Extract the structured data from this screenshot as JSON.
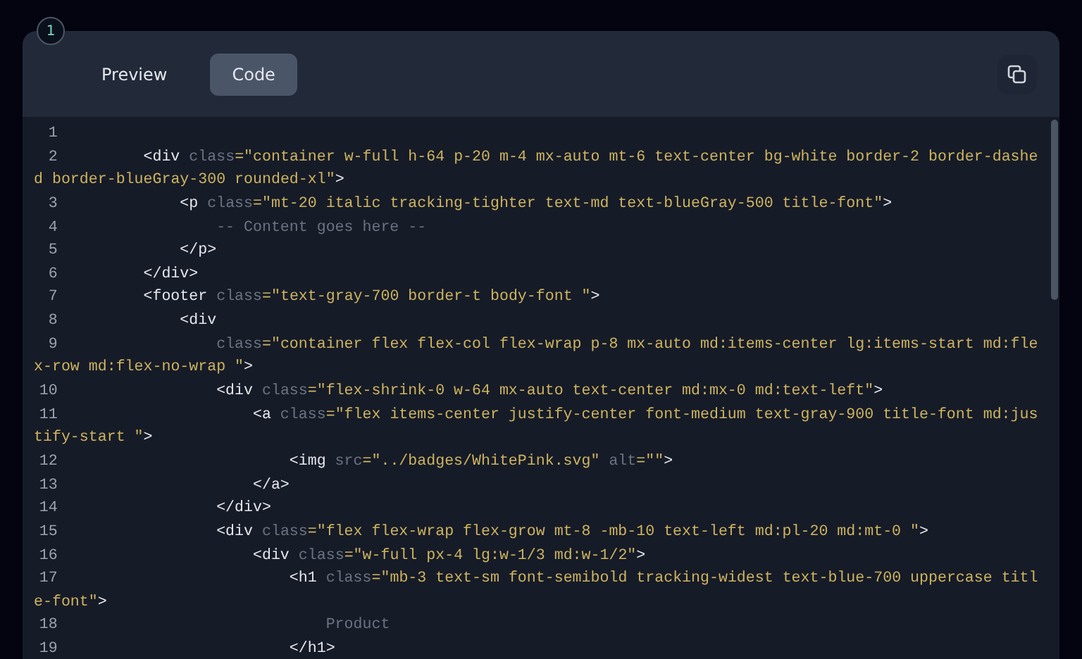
{
  "step_badge": "1",
  "tabs": [
    {
      "label": "Preview",
      "selected": false
    },
    {
      "label": "Code",
      "selected": true
    }
  ],
  "code_lines": [
    {
      "number": "1"
    },
    {
      "number": "2",
      "wrapped_parts": [
        {
          "tokens": [
            {
              "kind": "tag",
              "t": "        <div"
            },
            {
              "kind": "attr",
              "t": " class"
            },
            {
              "kind": "str",
              "t": "=\"container w-full h-64 p-20 m-4 mx-auto mt-6 text-center bg-white border-2 border-dashe"
            }
          ]
        },
        {
          "tokens": [
            {
              "kind": "str",
              "t": "d border-blueGray-300 rounded-xl\""
            },
            {
              "kind": "tag",
              "t": ">"
            }
          ]
        }
      ]
    },
    {
      "number": "3",
      "wrapped_parts": [
        {
          "tokens": [
            {
              "kind": "tag",
              "t": "            <p"
            },
            {
              "kind": "attr",
              "t": " class"
            },
            {
              "kind": "str",
              "t": "=\"mt-20 italic tracking-tighter text-md text-blueGray-500 title-font\""
            },
            {
              "kind": "tag",
              "t": ">"
            }
          ]
        }
      ]
    },
    {
      "number": "4",
      "wrapped_parts": [
        {
          "tokens": [
            {
              "kind": "text",
              "t": "                -- Content goes here --"
            }
          ]
        }
      ]
    },
    {
      "number": "5",
      "wrapped_parts": [
        {
          "tokens": [
            {
              "kind": "tag",
              "t": "            </p>"
            }
          ]
        }
      ]
    },
    {
      "number": "6",
      "wrapped_parts": [
        {
          "tokens": [
            {
              "kind": "tag",
              "t": "        </div>"
            }
          ]
        }
      ]
    },
    {
      "number": "7",
      "wrapped_parts": [
        {
          "tokens": [
            {
              "kind": "tag",
              "t": "        <footer"
            },
            {
              "kind": "attr",
              "t": " class"
            },
            {
              "kind": "str",
              "t": "=\"text-gray-700 border-t body-font \""
            },
            {
              "kind": "tag",
              "t": ">"
            }
          ]
        }
      ]
    },
    {
      "number": "8",
      "wrapped_parts": [
        {
          "tokens": [
            {
              "kind": "tag",
              "t": "            <div"
            }
          ]
        }
      ]
    },
    {
      "number": "9",
      "wrapped_parts": [
        {
          "tokens": [
            {
              "kind": "attr",
              "t": "                class"
            },
            {
              "kind": "str",
              "t": "=\"container flex flex-col flex-wrap p-8 mx-auto md:items-center lg:items-start md:fle"
            }
          ]
        },
        {
          "tokens": [
            {
              "kind": "str",
              "t": "x-row md:flex-no-wrap \""
            },
            {
              "kind": "tag",
              "t": ">"
            }
          ]
        }
      ]
    },
    {
      "number": "10",
      "wrapped_parts": [
        {
          "tokens": [
            {
              "kind": "tag",
              "t": "                <div"
            },
            {
              "kind": "attr",
              "t": " class"
            },
            {
              "kind": "str",
              "t": "=\"flex-shrink-0 w-64 mx-auto text-center md:mx-0 md:text-left\""
            },
            {
              "kind": "tag",
              "t": ">"
            }
          ]
        }
      ]
    },
    {
      "number": "11",
      "wrapped_parts": [
        {
          "tokens": [
            {
              "kind": "tag",
              "t": "                    <a"
            },
            {
              "kind": "attr",
              "t": " class"
            },
            {
              "kind": "str",
              "t": "=\"flex items-center justify-center font-medium text-gray-900 title-font md:jus"
            }
          ]
        },
        {
          "tokens": [
            {
              "kind": "str",
              "t": "tify-start \""
            },
            {
              "kind": "tag",
              "t": ">"
            }
          ]
        }
      ]
    },
    {
      "number": "12",
      "wrapped_parts": [
        {
          "tokens": [
            {
              "kind": "tag",
              "t": "                        <img"
            },
            {
              "kind": "attr",
              "t": " src"
            },
            {
              "kind": "str",
              "t": "=\"../badges/WhitePink.svg\""
            },
            {
              "kind": "attr",
              "t": " alt"
            },
            {
              "kind": "str",
              "t": "=\"\""
            },
            {
              "kind": "tag",
              "t": ">"
            }
          ]
        }
      ]
    },
    {
      "number": "13",
      "wrapped_parts": [
        {
          "tokens": [
            {
              "kind": "tag",
              "t": "                    </a>"
            }
          ]
        }
      ]
    },
    {
      "number": "14",
      "wrapped_parts": [
        {
          "tokens": [
            {
              "kind": "tag",
              "t": "                </div>"
            }
          ]
        }
      ]
    },
    {
      "number": "15",
      "wrapped_parts": [
        {
          "tokens": [
            {
              "kind": "tag",
              "t": "                <div"
            },
            {
              "kind": "attr",
              "t": " class"
            },
            {
              "kind": "str",
              "t": "=\"flex flex-wrap flex-grow mt-8 -mb-10 text-left md:pl-20 md:mt-0 \""
            },
            {
              "kind": "tag",
              "t": ">"
            }
          ]
        }
      ]
    },
    {
      "number": "16",
      "wrapped_parts": [
        {
          "tokens": [
            {
              "kind": "tag",
              "t": "                    <div"
            },
            {
              "kind": "attr",
              "t": " class"
            },
            {
              "kind": "str",
              "t": "=\"w-full px-4 lg:w-1/3 md:w-1/2\""
            },
            {
              "kind": "tag",
              "t": ">"
            }
          ]
        }
      ]
    },
    {
      "number": "17",
      "wrapped_parts": [
        {
          "tokens": [
            {
              "kind": "tag",
              "t": "                        <h1"
            },
            {
              "kind": "attr",
              "t": " class"
            },
            {
              "kind": "str",
              "t": "=\"mb-3 text-sm font-semibold tracking-widest text-blue-700 uppercase titl"
            }
          ]
        },
        {
          "tokens": [
            {
              "kind": "str",
              "t": "e-font\""
            },
            {
              "kind": "tag",
              "t": ">"
            }
          ]
        }
      ]
    },
    {
      "number": "18",
      "wrapped_parts": [
        {
          "tokens": [
            {
              "kind": "text",
              "t": "                            Product"
            }
          ]
        }
      ]
    },
    {
      "number": "19",
      "wrapped_parts": [
        {
          "tokens": [
            {
              "kind": "tag",
              "t": "                        </h1>"
            }
          ]
        }
      ]
    }
  ]
}
